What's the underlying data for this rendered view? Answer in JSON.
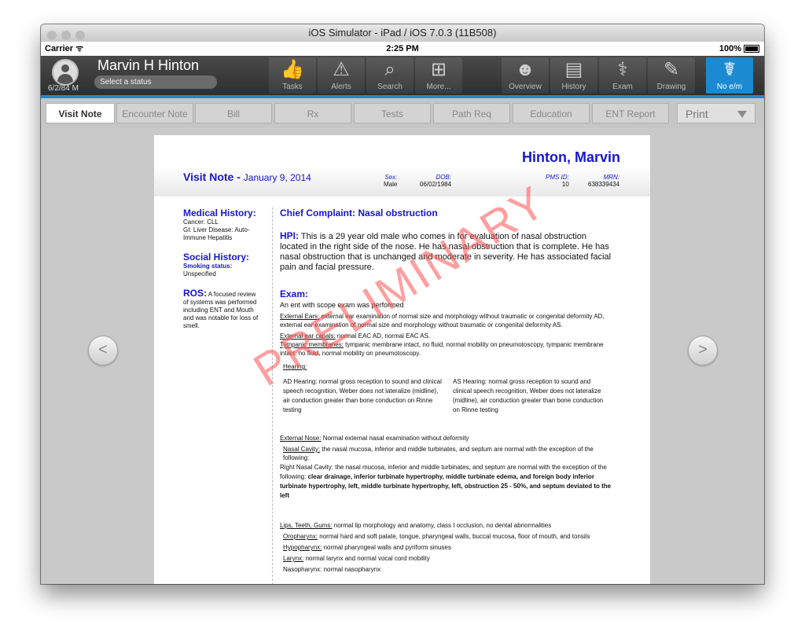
{
  "window": {
    "title": "iOS Simulator - iPad / iOS 7.0.3 (11B508)"
  },
  "statusbar": {
    "carrier": "Carrier ᯤ",
    "time": "2:25 PM",
    "battery": "100%"
  },
  "patient": {
    "name": "Marvin H Hinton",
    "dob_short": "6/2/84 M",
    "status_placeholder": "Select a status"
  },
  "header_buttons": [
    {
      "label": "Tasks",
      "icon": "thumbs-up-icon"
    },
    {
      "label": "Alerts",
      "icon": "alert-icon"
    },
    {
      "label": "Search",
      "icon": "search-icon"
    },
    {
      "label": "More...",
      "icon": "hierarchy-icon"
    },
    {
      "label": "Overview",
      "icon": "profile-head-icon"
    },
    {
      "label": "History",
      "icon": "clipboard-icon"
    },
    {
      "label": "Exam",
      "icon": "stethoscope-icon"
    },
    {
      "label": "Drawing",
      "icon": "palette-icon"
    },
    {
      "label": "No e/m",
      "icon": "caduceus-icon",
      "active": true
    }
  ],
  "tabs": [
    "Visit Note",
    "Encounter Note",
    "Bill",
    "Rx",
    "Tests",
    "Path Req",
    "Education",
    "ENT Report"
  ],
  "print_label": "Print",
  "note": {
    "patient_name": "Hinton, Marvin",
    "title": "Visit Note - ",
    "date": "January 9, 2014",
    "sex_label": "Sex:",
    "sex": "Male",
    "dob_label": "DOB:",
    "dob": "06/02/1984",
    "pms_label": "PMS ID:",
    "pms": "10",
    "mrn_label": "MRN:",
    "mrn": "638339434",
    "medical_history_h": "Medical History:",
    "medical_history": [
      "Cancer: CLL",
      "GI: Liver Disease: Auto-Immune Hepatitis"
    ],
    "social_history_h": "Social History:",
    "smoking_label": "Smoking status:",
    "smoking": "Unspecified",
    "ros_h": "ROS:",
    "ros": "A focused review of systems was performed including ENT and Mouth and was notable for loss of smell.",
    "chief_complaint": "Chief Complaint: Nasal obstruction",
    "hpi_label": "HPI:",
    "hpi": "This is a 29 year old male who comes in for evaluation of nasal obstruction located in the right side of the nose. He has nasal obstruction that is complete. He has nasal obstruction that is unchanged and moderate in severity. He has associated facial pain and facial pressure.",
    "exam_h": "Exam:",
    "exam_intro": "An ent with scope exam was performed",
    "ext_ears_label": "External Ears:",
    "ext_ears": " external ear examination of normal size and morphology without traumatic or congenital deformity AD, external ear examination of normal size and morphology without traumatic or congenital deformity AS.",
    "ext_canals_label": "External ear canals:",
    "ext_canals": " normal EAC AD, normal EAC AS.",
    "tymp_label": "Tympanic membranes:",
    "tymp": " tympanic membrane intact, no fluid, normal mobility on pneumotoscopy, tympanic membrane intact, no fluid, normal mobility on pneumotoscopy.",
    "hearing_label": "Hearing:",
    "hearing_ad": "AD Hearing: normal gross reception to sound and clinical speech recognition, Weber does not lateralize (midline), air conduction greater than bone conduction on Rinne testing",
    "hearing_as": "AS Hearing: normal gross reception to sound and clinical speech recognition, Weber does not lateralize (midline), air conduction greater than bone conduction on Rinne testing",
    "ext_nose_label": "External Nose:",
    "ext_nose": " Normal external nasal examination without deformity",
    "nasal_cavity_label": "Nasal Cavity:",
    "nasal_cavity": " the nasal mucosa, inferior and middle turbinates, and septum are normal with the exception of the following:",
    "right_nasal": "Right Nasal Cavity: the nasal mucosa, inferior and middle turbinates, and septum are normal with the exception of the following: ",
    "right_nasal_bold": "clear drainage, inferior turbinate hypertrophy, middle turbinate edema, and foreign body inferior turbinate hypertrophy, left, middle turbinate hypertrophy, left, obstruction 25 - 50%, and septum deviated to the left",
    "lips_label": "Lips, Teeth, Gums:",
    "lips": " normal lip morphology and anatomy, class I occlusion, no dental abnormalities",
    "oro_label": "Oropharynx:",
    "oro": " normal hard and soft palate, tongue, pharyngeal walls, buccal mucosa, floor of mouth, and tonsils",
    "hypo_label": "Hypopharynx:",
    "hypo": " normal pharyngeal walls and pyriform sinuses",
    "larynx_label": "Larynx:",
    "larynx": " normal larynx and normal vocal cord mobility",
    "naso_label": "Nasopharynx:",
    "naso": " normal nasopharynx",
    "watermark": "PRELIMINARY"
  },
  "colors": {
    "accent": "#1c8ad0",
    "note_blue": "#1515d6",
    "watermark": "#ff5050"
  }
}
